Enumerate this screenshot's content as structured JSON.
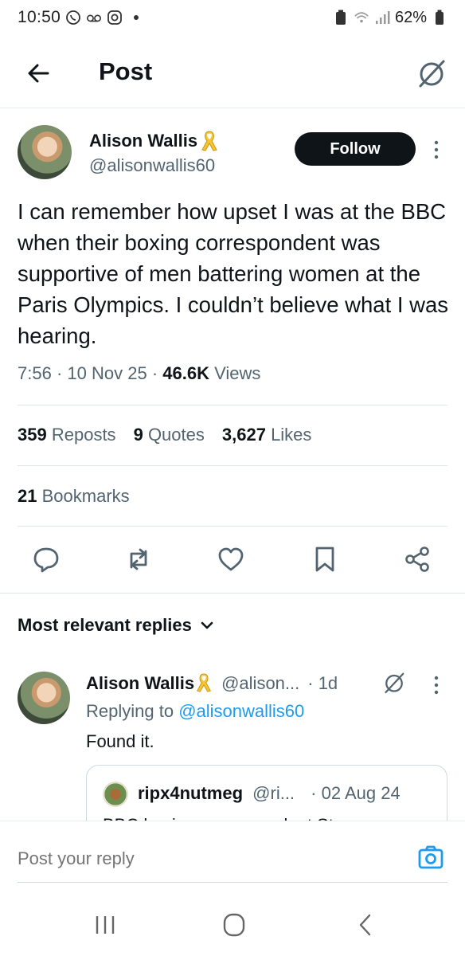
{
  "status_bar": {
    "time": "10:50",
    "battery": "62%"
  },
  "header": {
    "title": "Post"
  },
  "post": {
    "author_name": "Alison Wallis",
    "author_handle": "@alisonwallis60",
    "follow_label": "Follow",
    "text": "I can remember how upset I was at the BBC when their boxing correspondent was supportive of men battering women at the Paris Olympics. I couldn’t believe what I was hearing.",
    "time": "7:56",
    "date": "10 Nov 25",
    "views_count": "46.6K",
    "views_label": "Views",
    "reposts_count": "359",
    "reposts_label": "Reposts",
    "quotes_count": "9",
    "quotes_label": "Quotes",
    "likes_count": "3,627",
    "likes_label": "Likes",
    "bookmarks_count": "21",
    "bookmarks_label": "Bookmarks"
  },
  "replies_section": {
    "sort_label": "Most relevant replies"
  },
  "reply": {
    "author_name": "Alison Wallis",
    "author_handle": "@alison...",
    "time": "· 1d",
    "replying_prefix": "Replying to",
    "replying_mention": "@alisonwallis60",
    "text": "Found it.",
    "quote": {
      "author_name": "ripx4nutmeg",
      "author_handle": "@ri...",
      "date": "· 02 Aug 24",
      "text_cut": "BBC boxing correspondent St..."
    }
  },
  "reply_bar": {
    "placeholder": "Post your reply"
  },
  "colors": {
    "text_primary": "#0f1419",
    "text_secondary": "#536471",
    "link": "#1d9bf0",
    "follow_bg": "#0f1419"
  }
}
